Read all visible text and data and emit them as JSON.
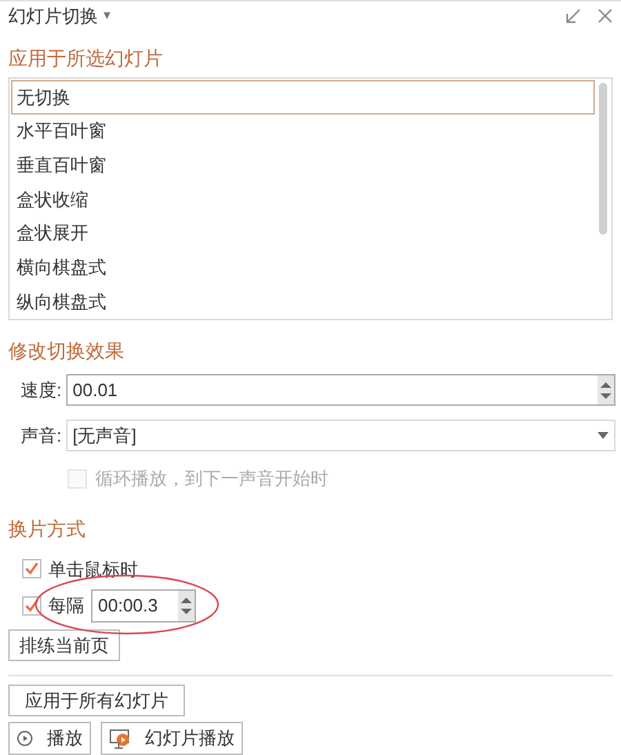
{
  "panel": {
    "title": "幻灯片切换",
    "caret": "▾"
  },
  "apply_section": {
    "heading": "应用于所选幻灯片",
    "items": [
      {
        "label": "无切换",
        "selected": true
      },
      {
        "label": "水平百叶窗",
        "selected": false
      },
      {
        "label": "垂直百叶窗",
        "selected": false
      },
      {
        "label": "盒状收缩",
        "selected": false
      },
      {
        "label": "盒状展开",
        "selected": false
      },
      {
        "label": "横向棋盘式",
        "selected": false
      },
      {
        "label": "纵向棋盘式",
        "selected": false
      }
    ]
  },
  "modify_section": {
    "heading": "修改切换效果",
    "speed": {
      "label": "速度:",
      "value": "00.01"
    },
    "sound": {
      "label": "声音:",
      "value": "[无声音]"
    },
    "loop": {
      "label": "循环播放，到下一声音开始时",
      "checked": false,
      "disabled": true
    }
  },
  "advance_section": {
    "heading": "换片方式",
    "on_click": {
      "label": "单击鼠标时",
      "checked": true
    },
    "every": {
      "label": "每隔",
      "checked": true,
      "value": "00:00.3",
      "highlighted": true
    },
    "rehearse_button": "排练当前页"
  },
  "apply_all_button": "应用于所有幻灯片",
  "footer_buttons": [
    {
      "kind": "play",
      "label": "播放"
    },
    {
      "kind": "slideshow",
      "label": "幻灯片播放"
    }
  ]
}
